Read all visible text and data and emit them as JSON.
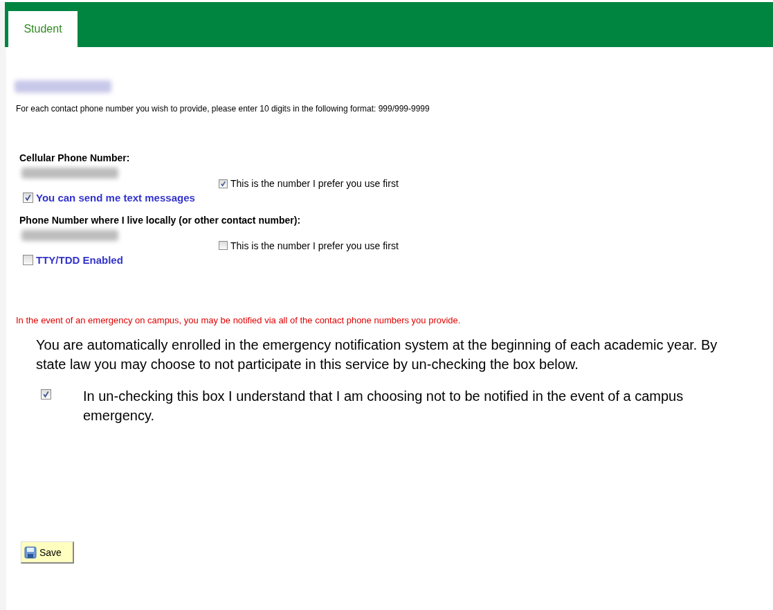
{
  "tabs": [
    {
      "label": "Student",
      "selected": true
    }
  ],
  "instructions": "For each contact phone number you wish to provide, please enter 10 digits in the following format:  999/999-9999",
  "phones": [
    {
      "label": "Cellular Phone Number:",
      "prefer": {
        "label": "This is the number I prefer you use first",
        "checked": true
      },
      "option": {
        "label": "You can send me text messages",
        "checked": true
      }
    },
    {
      "label": "Phone Number where I live locally (or other contact number):",
      "prefer": {
        "label": "This is the number I prefer you use first",
        "checked": false
      },
      "option": {
        "label": "TTY/TDD Enabled",
        "checked": false
      }
    }
  ],
  "emergency_notice": "In the event of an emergency on campus, you may be notified via all of the contact phone numbers you provide.",
  "enrollment_text": "You are automatically enrolled in the emergency notification system at the beginning of each academic year. By state law you may choose to not participate in this service by un-checking the box below.",
  "opt_out": {
    "label": "In un-checking this box I understand that I am choosing not to be notified in the event of a campus emergency.",
    "checked": true
  },
  "save_button": "Save"
}
